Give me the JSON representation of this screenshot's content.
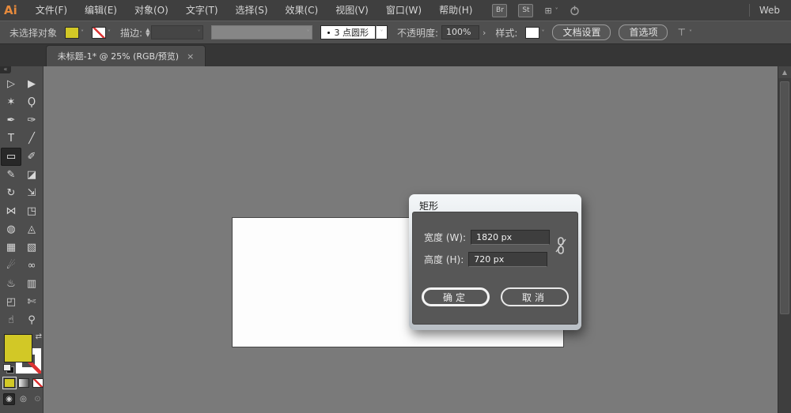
{
  "colors": {
    "fill_yellow": "#d2c826",
    "none_red": "#dd3333",
    "logo_orange": "#e68a3c"
  },
  "menu_bar": {
    "logo": "Ai",
    "items": [
      "文件(F)",
      "编辑(E)",
      "对象(O)",
      "文字(T)",
      "选择(S)",
      "效果(C)",
      "视图(V)",
      "窗口(W)",
      "帮助(H)"
    ],
    "bridge": "Br",
    "stock": "St",
    "workspace": "Web"
  },
  "control_bar": {
    "status": "未选择对象",
    "stroke_label": "描边:",
    "brush_value": "3 点圆形",
    "opacity_label": "不透明度:",
    "opacity_value": "100%",
    "more": "›",
    "style_label": "样式:",
    "doc_setup": "文档设置",
    "preferences": "首选项"
  },
  "tab": {
    "title": "未标题-1* @ 25% (RGB/预览)",
    "close": "×"
  },
  "toolbar": {
    "tools": [
      {
        "name": "selection-tool",
        "glyph": "▷"
      },
      {
        "name": "direct-selection-tool",
        "glyph": "▶"
      },
      {
        "name": "magic-wand-tool",
        "glyph": "✶"
      },
      {
        "name": "lasso-tool",
        "glyph": "Ϙ"
      },
      {
        "name": "pen-tool",
        "glyph": "✒"
      },
      {
        "name": "blob-brush-tool",
        "glyph": "✑"
      },
      {
        "name": "type-tool",
        "glyph": "T"
      },
      {
        "name": "line-segment-tool",
        "glyph": "╱"
      },
      {
        "name": "rectangle-tool",
        "glyph": "▭",
        "selected": true
      },
      {
        "name": "paintbrush-tool",
        "glyph": "✐"
      },
      {
        "name": "pencil-tool",
        "glyph": "✎"
      },
      {
        "name": "eraser-tool",
        "glyph": "◪"
      },
      {
        "name": "rotate-tool",
        "glyph": "↻"
      },
      {
        "name": "scale-tool",
        "glyph": "⇲"
      },
      {
        "name": "width-tool",
        "glyph": "⋈"
      },
      {
        "name": "free-transform-tool",
        "glyph": "◳"
      },
      {
        "name": "shape-builder-tool",
        "glyph": "◍"
      },
      {
        "name": "perspective-grid-tool",
        "glyph": "◬"
      },
      {
        "name": "mesh-tool",
        "glyph": "▦"
      },
      {
        "name": "gradient-tool",
        "glyph": "▧"
      },
      {
        "name": "eyedropper-tool",
        "glyph": "☄"
      },
      {
        "name": "blend-tool",
        "glyph": "∞"
      },
      {
        "name": "symbol-sprayer-tool",
        "glyph": "♨"
      },
      {
        "name": "column-graph-tool",
        "glyph": "▥"
      },
      {
        "name": "artboard-tool",
        "glyph": "◰"
      },
      {
        "name": "slice-tool",
        "glyph": "✄"
      },
      {
        "name": "hand-tool",
        "glyph": "☝"
      },
      {
        "name": "zoom-tool",
        "glyph": "⚲"
      }
    ]
  },
  "dialog": {
    "title": "矩形",
    "width_label": "宽度 (W):",
    "width_value": "1820 px",
    "height_label": "高度 (H):",
    "height_value": "720 px",
    "ok": "确定",
    "cancel": "取消"
  }
}
